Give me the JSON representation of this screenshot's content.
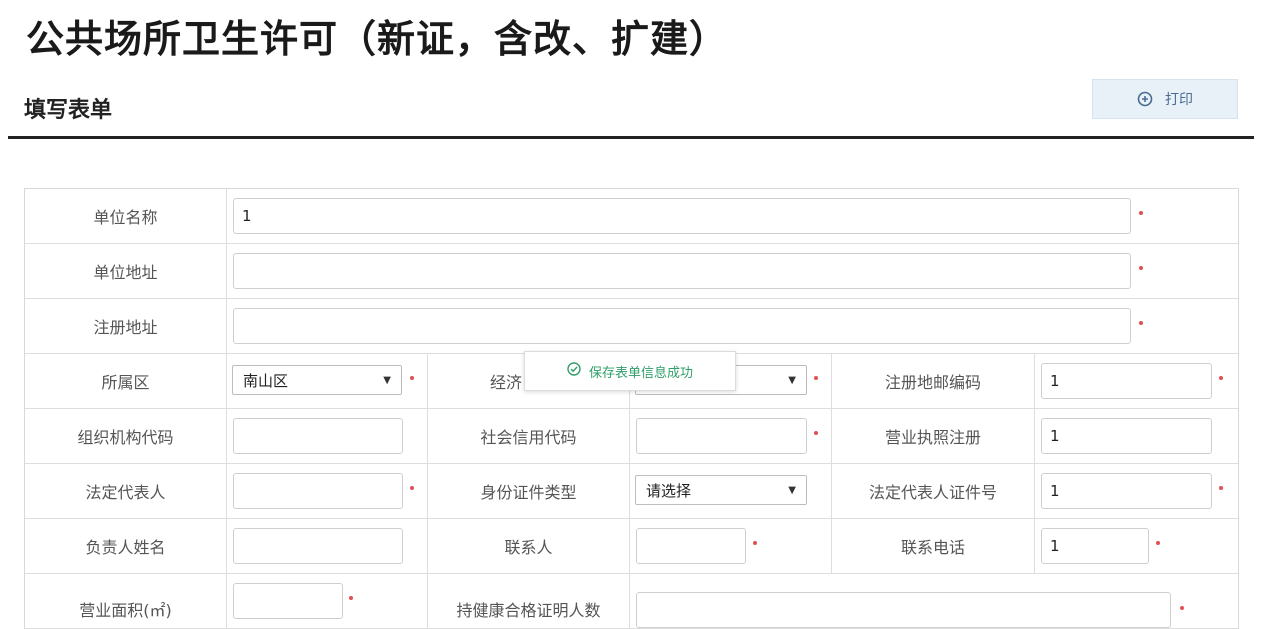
{
  "page_title": "公共场所卫生许可（新证，含改、扩建）",
  "section_title": "填写表单",
  "print_button": {
    "label": "打印"
  },
  "toast": {
    "message": "保存表单信息成功"
  },
  "form": {
    "unit_name": {
      "label": "单位名称",
      "value": "1"
    },
    "unit_address": {
      "label": "单位地址",
      "value": ""
    },
    "registered_address": {
      "label": "注册地址",
      "value": ""
    },
    "district": {
      "label": "所属区",
      "value": "南山区"
    },
    "economic_type": {
      "label": "经济",
      "value": ""
    },
    "postal_code": {
      "label": "注册地邮编码",
      "value": "1"
    },
    "org_code": {
      "label": "组织机构代码",
      "value": ""
    },
    "credit_code": {
      "label": "社会信用代码",
      "value": ""
    },
    "business_license": {
      "label": "营业执照注册",
      "value": "1"
    },
    "legal_rep": {
      "label": "法定代表人",
      "value": ""
    },
    "id_type": {
      "label": "身份证件类型",
      "value": "请选择"
    },
    "legal_rep_id": {
      "label": "法定代表人证件号",
      "value": "1"
    },
    "manager_name": {
      "label": "负责人姓名",
      "value": ""
    },
    "contact": {
      "label": "联系人",
      "value": ""
    },
    "contact_phone": {
      "label": "联系电话",
      "value": "1"
    },
    "business_area": {
      "label": "营业面积(㎡)",
      "value": ""
    },
    "health_cert_count": {
      "label": "持健康合格证明人数",
      "value": ""
    }
  }
}
